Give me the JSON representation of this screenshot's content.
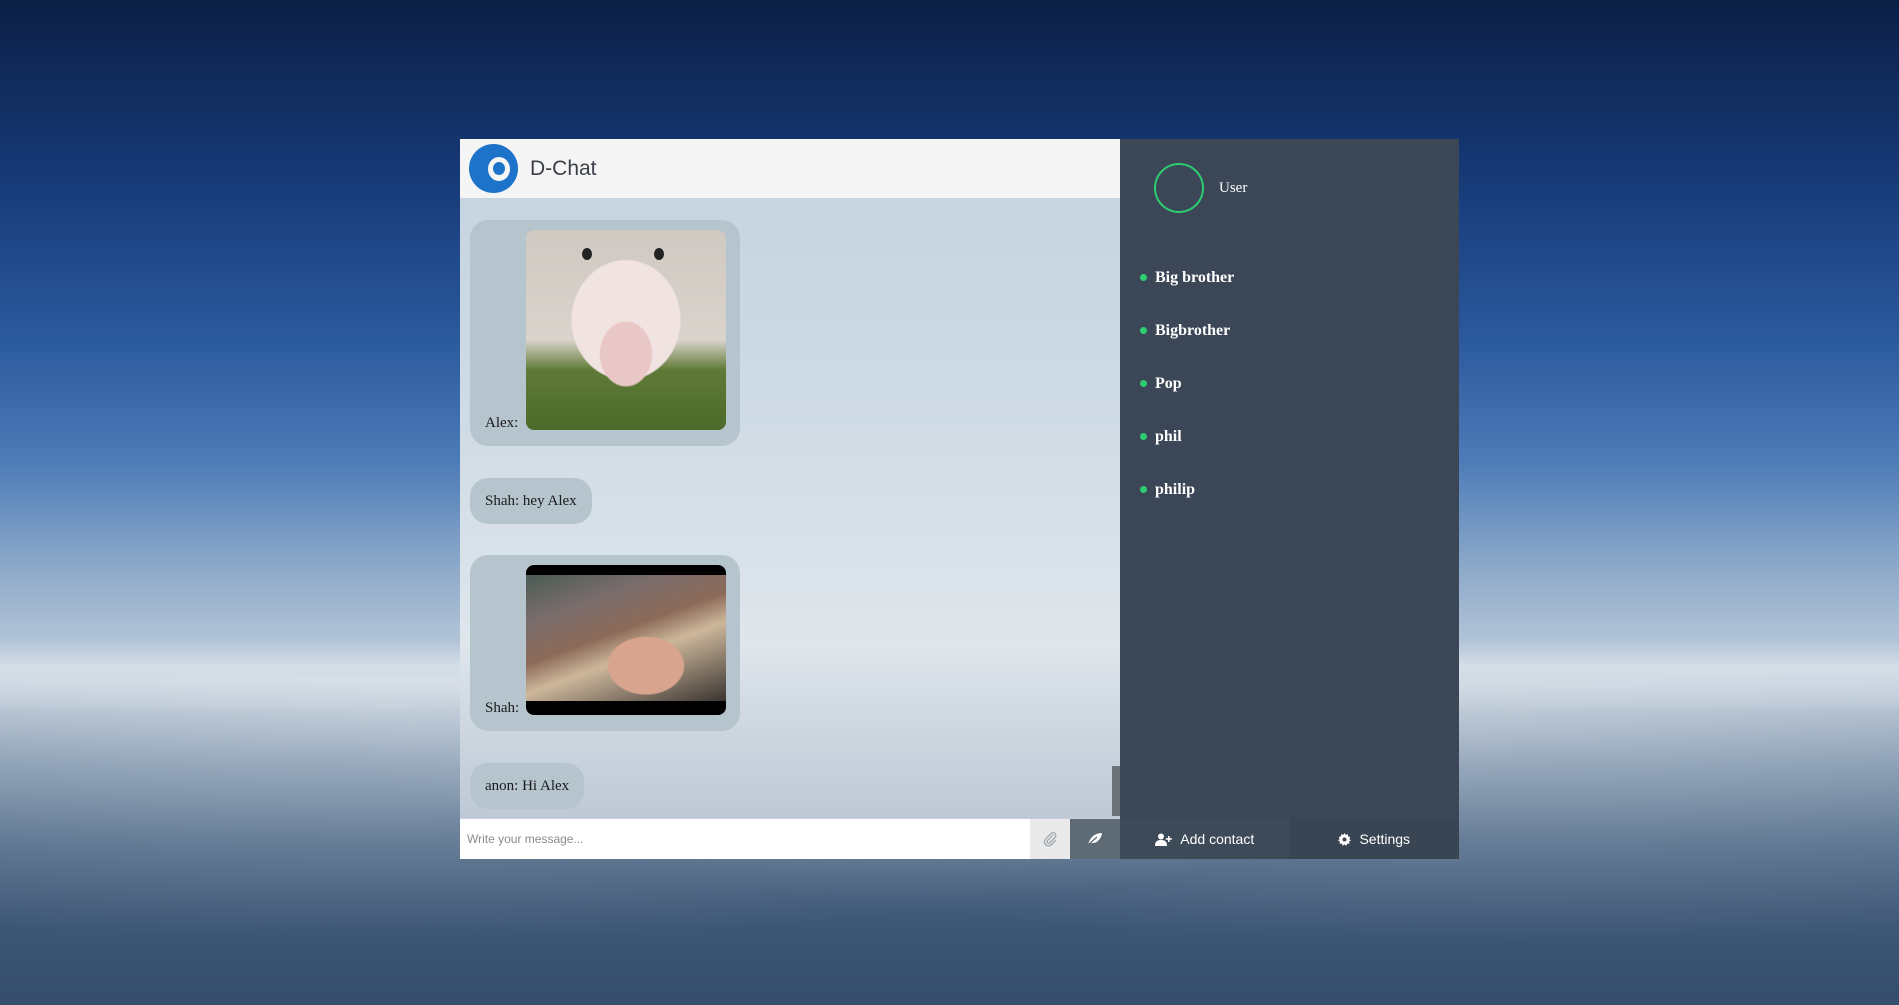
{
  "app": {
    "title": "D-Chat"
  },
  "messages": [
    {
      "kind": "image",
      "sender": "Alex:",
      "image": "pig-looking-at-camera"
    },
    {
      "kind": "text",
      "text": "Shah: hey Alex"
    },
    {
      "kind": "image",
      "sender": "Shah:",
      "image": "pig-sleeping-under-blanket"
    },
    {
      "kind": "text",
      "text": "anon: Hi Alex"
    }
  ],
  "composer": {
    "placeholder": "Write your message...",
    "attach_icon": "paperclip-icon",
    "send_icon": "leaf-send-icon"
  },
  "sidebar": {
    "user": {
      "name": "User"
    },
    "contacts": [
      {
        "name": "Big brother",
        "status": "online"
      },
      {
        "name": "Bigbrother",
        "status": "online"
      },
      {
        "name": "Pop",
        "status": "online"
      },
      {
        "name": "phil",
        "status": "online"
      },
      {
        "name": "philip",
        "status": "online"
      }
    ],
    "add_contact_label": "Add contact",
    "settings_label": "Settings"
  },
  "colors": {
    "online": "#2ecc71",
    "sidebar_bg": "#3b4756",
    "brand": "#1d72c9"
  }
}
